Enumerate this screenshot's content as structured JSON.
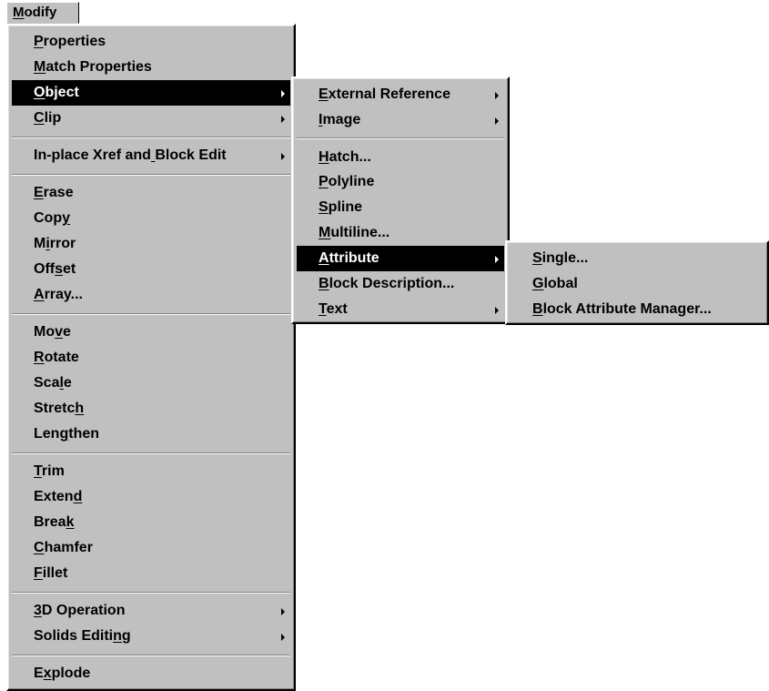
{
  "menubar": {
    "modify": "Modify"
  },
  "modify_menu": {
    "properties": "Properties",
    "match_properties": "Match Properties",
    "object": "Object",
    "clip": "Clip",
    "inplace_xref": "In-place Xref and Block Edit",
    "erase": "Erase",
    "copy": "Copy",
    "mirror": "Mirror",
    "offset": "Offset",
    "array": "Array...",
    "move": "Move",
    "rotate": "Rotate",
    "scale": "Scale",
    "stretch": "Stretch",
    "lengthen": "Lengthen",
    "trim": "Trim",
    "extend": "Extend",
    "break": "Break",
    "chamfer": "Chamfer",
    "fillet": "Fillet",
    "operation_3d": "3D Operation",
    "solids_editing": "Solids Editing",
    "explode": "Explode"
  },
  "object_menu": {
    "external_reference": "External Reference",
    "image": "Image",
    "hatch": "Hatch...",
    "polyline": "Polyline",
    "spline": "Spline",
    "multiline": "Multiline...",
    "attribute": "Attribute",
    "block_description": "Block Description...",
    "text": "Text"
  },
  "attribute_menu": {
    "single": "Single...",
    "global": "Global",
    "block_attribute_manager": "Block Attribute Manager..."
  },
  "colors": {
    "menu_bg": "#c0c0c0",
    "highlight_bg": "#000000",
    "highlight_fg": "#ffffff"
  }
}
